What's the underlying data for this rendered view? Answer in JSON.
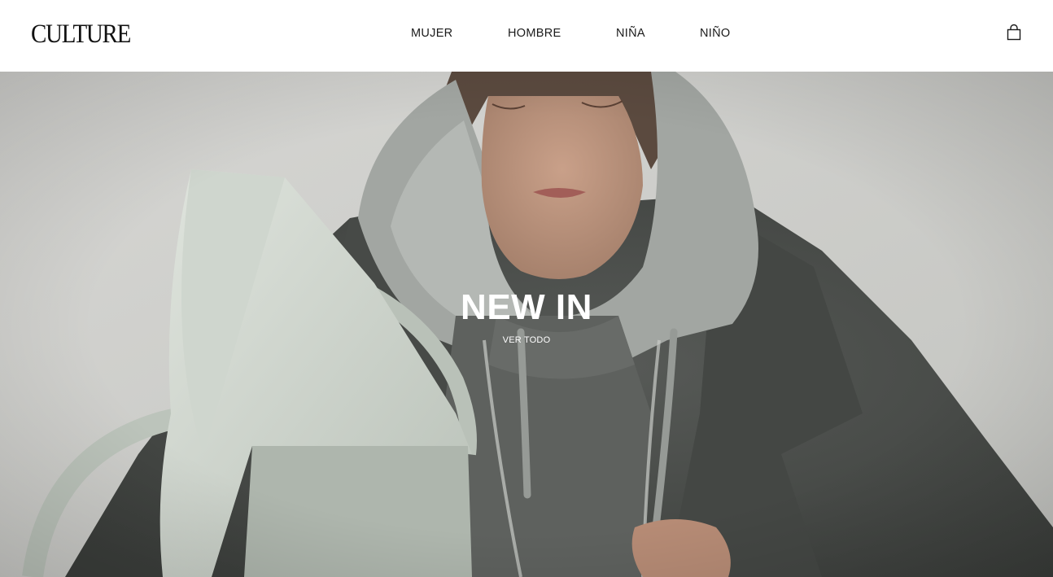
{
  "header": {
    "logo": "CULTURE",
    "nav": [
      {
        "label": "MUJER"
      },
      {
        "label": "HOMBRE"
      },
      {
        "label": "NIÑA"
      },
      {
        "label": "NIÑO"
      }
    ],
    "cart_icon": "shopping-bag-icon"
  },
  "hero": {
    "title": "NEW IN",
    "link_label": "VER TODO",
    "image_subject": "model-hood-coat-bag-photo"
  },
  "colors": {
    "background": "#ffffff",
    "text": "#111111",
    "hero_text": "#ffffff",
    "hero_backdrop": "#d9d9d6",
    "coat": "#4a4d4a",
    "hoodie": "#9ea29e",
    "bag": "#c9d0c8"
  }
}
